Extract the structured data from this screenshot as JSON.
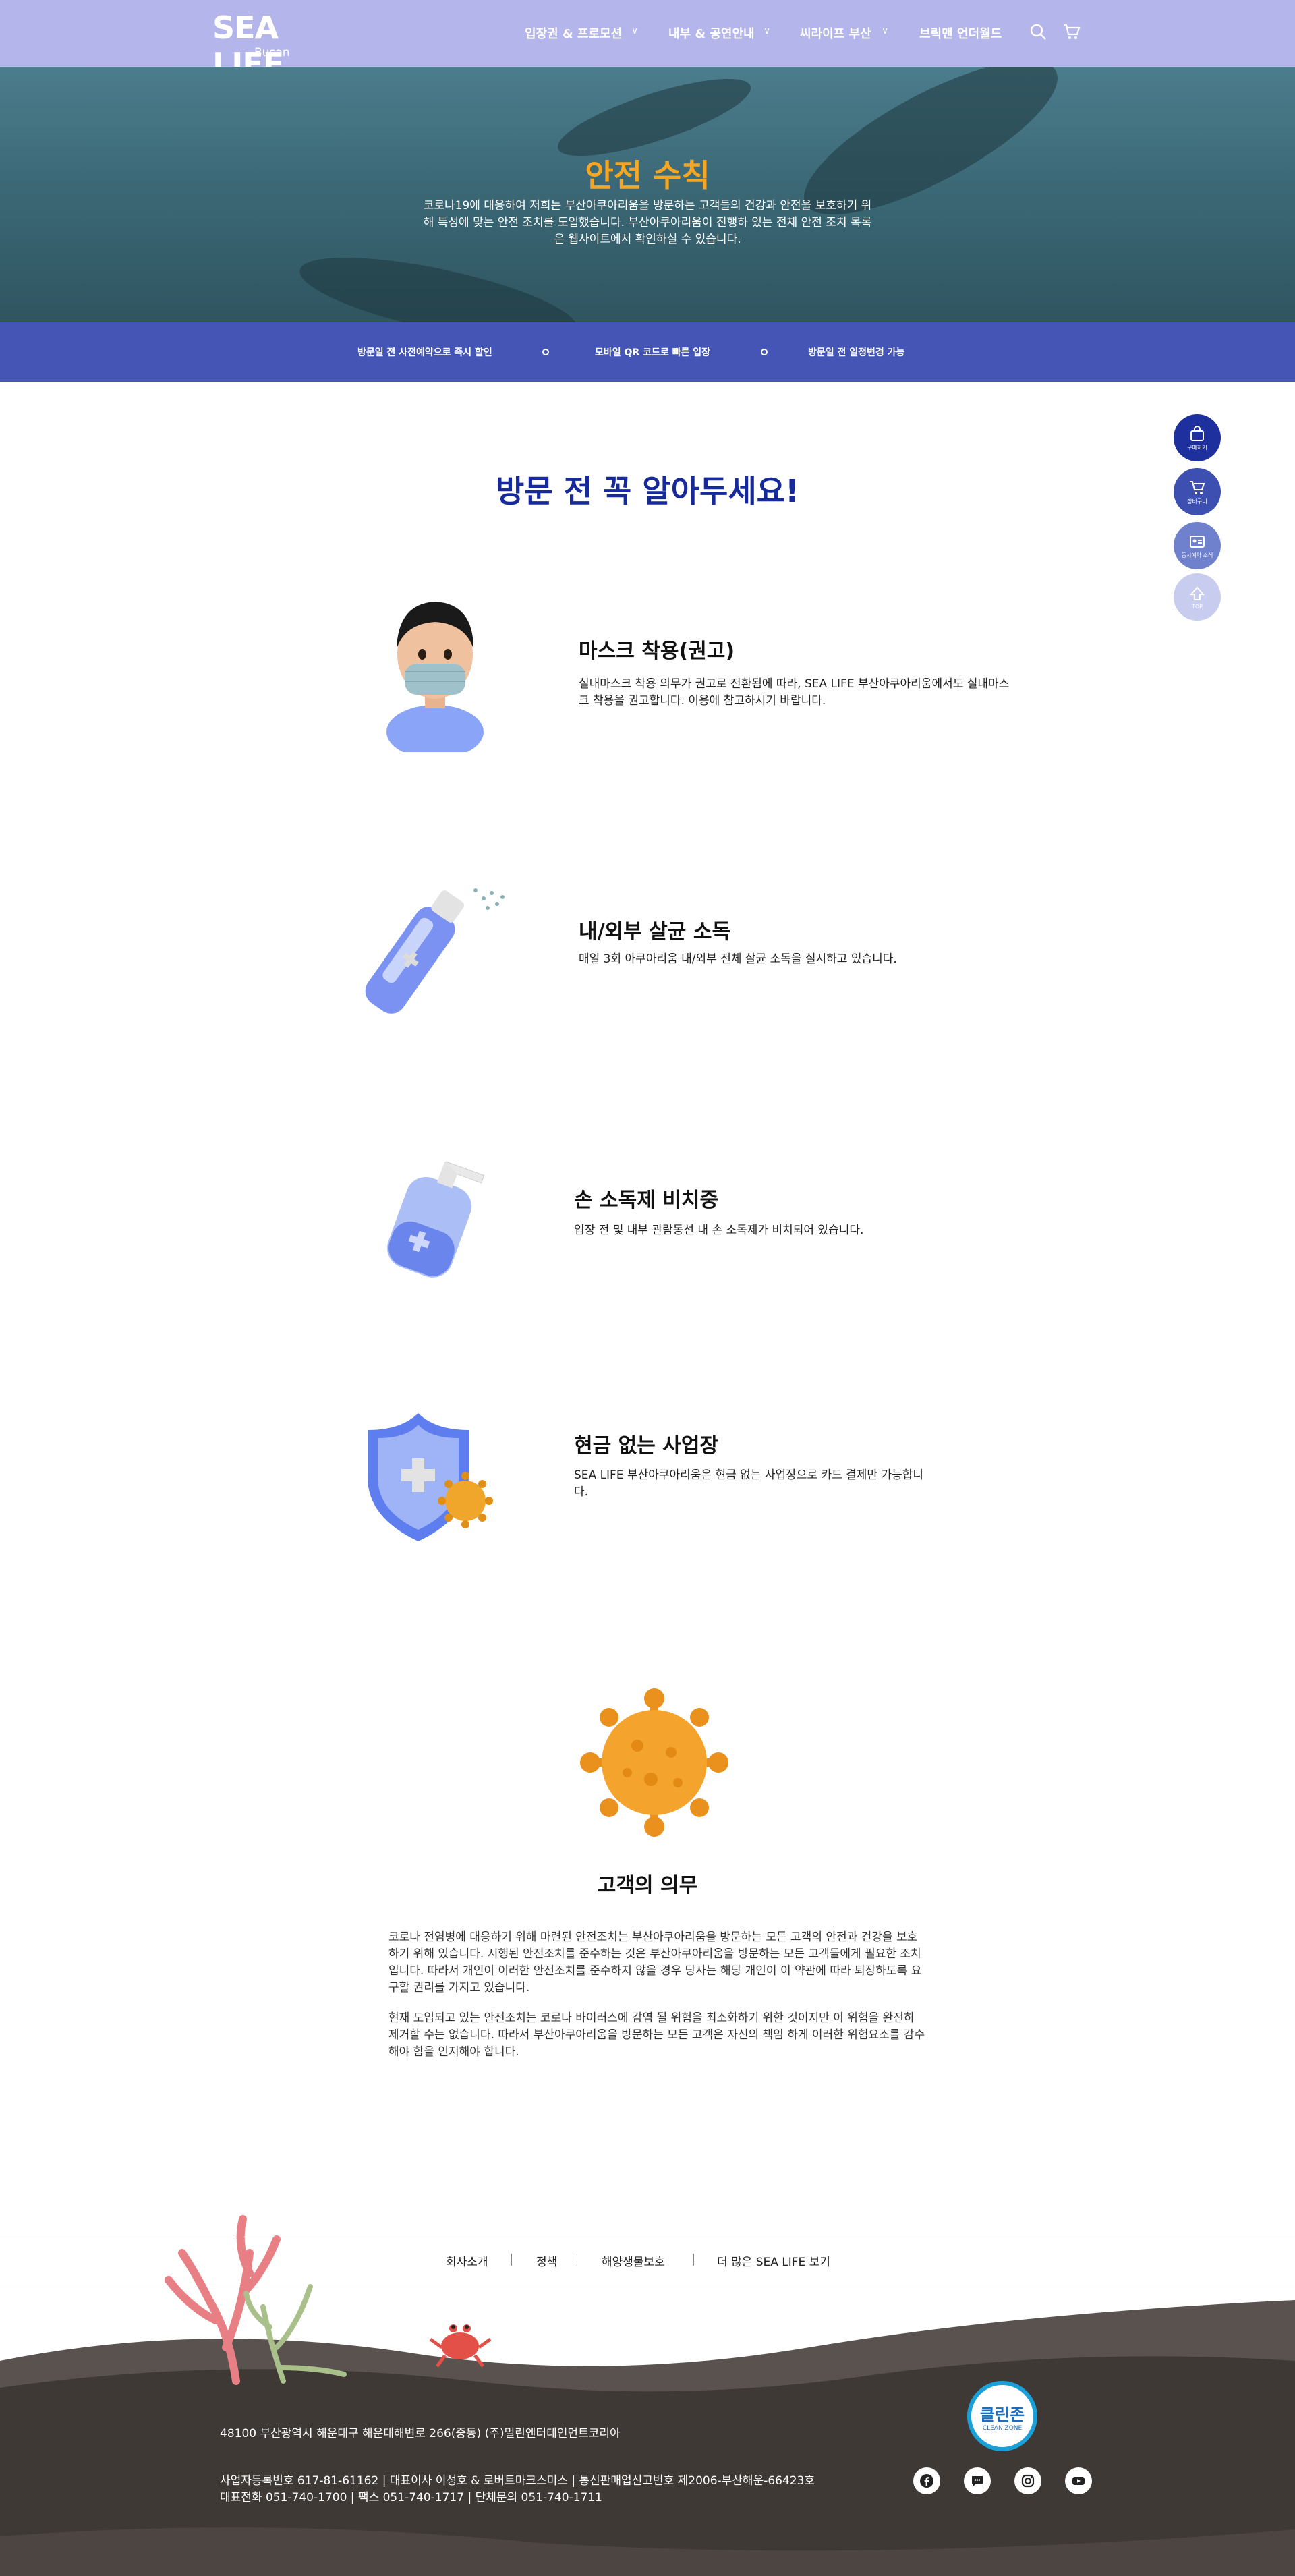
{
  "header": {
    "logo_main": "SEA LIFE",
    "logo_sub": "Busan",
    "nav": [
      {
        "label": "입장권 & 프로모션"
      },
      {
        "label": "내부 & 공연안내"
      },
      {
        "label": "씨라이프 부산"
      },
      {
        "label": "브릭맨 언더월드"
      }
    ]
  },
  "hero": {
    "title": "안전 수칙",
    "text": "코로나19에 대응하여 저희는 부산아쿠아리움을 방문하는 고객들의 건강과 안전을 보호하기 위해 특성에 맞는 안전 조치를 도입했습니다. 부산아쿠아리움이 진행하 있는 전체 안전 조치 목록은 웹사이트에서 확인하실 수 있습니다."
  },
  "band": {
    "items": [
      "방문일 전 사전예약으로 즉시 할인",
      "모바일 QR 코드로 빠른 입장",
      "방문일 전 일정변경 가능"
    ]
  },
  "floating": [
    {
      "label": "구매하기",
      "icon": "shopping-bag-icon"
    },
    {
      "label": "장바구니",
      "icon": "cart-icon"
    },
    {
      "label": "동시예약 소식",
      "icon": "id-card-icon"
    },
    {
      "label": "TOP",
      "icon": "arrow-up-icon"
    }
  ],
  "main": {
    "title": "방문 전 꼭 알아두세요!",
    "items": [
      {
        "title": "마스크 착용(권고)",
        "desc": "실내마스크 착용 의무가 권고로 전환됨에 따라, SEA LIFE 부산아쿠아리움에서도 실내마스크 착용을 권고합니다. 이용에 참고하시기 바랍니다.",
        "icon": "masked-person-icon"
      },
      {
        "title": "내/외부 살균 소독",
        "desc": "매일 3회 아쿠아리움 내/외부 전체 살균 소독을 실시하고 있습니다.",
        "icon": "spray-bottle-icon"
      },
      {
        "title": "손 소독제 비치중",
        "desc": "입장 전 및 내부 관람동선 내 손 소독제가 비치되어 있습니다.",
        "icon": "hand-sanitizer-icon"
      },
      {
        "title": "현금 없는 사업장",
        "desc": "SEA LIFE 부산아쿠아리움은 현금 없는 사업장으로 카드 결제만 가능합니다.",
        "icon": "shield-virus-icon"
      }
    ],
    "duty": {
      "title": "고객의 의무",
      "p1": "코로나 전염병에 대응하기 위해 마련된 안전조치는 부산아쿠아리움을 방문하는 모든 고객의 안전과 건강을 보호하기 위해 있습니다. 시행된 안전조치를 준수하는 것은 부산아쿠아리움을 방문하는 모든 고객들에게 필요한 조치입니다. 따라서 개인이 이러한 안전조치를 준수하지 않을 경우 당사는 해당 개인이 이 약관에 따라 퇴장하도록 요구할 권리를 가지고 있습니다.",
      "p2": "현재 도입되고 있는 안전조치는 코로나 바이러스에 감염 될 위험을 최소화하기 위한 것이지만 이 위험을 완전히 제거할 수는 없습니다. 따라서 부산아쿠아리움을 방문하는 모든 고객은 자신의 책임 하게 이러한 위험요소를 감수해야 함을 인지해야 합니다."
    }
  },
  "footer": {
    "links": [
      "회사소개",
      "정책",
      "해양생물보호",
      "더 많은 SEA LIFE 보기"
    ],
    "address": "48100 부산광역시 해운대구 해운대해변로 266(중동) (주)멀린엔터테인먼트코리아",
    "biz_line1": "사업자등록번호 617-81-61162 | 대표이사 이성호 & 로버트마크스미스 | 통신판매업신고번호 제2006-부산해운-66423호",
    "biz_line2": "대표전화 051-740-1700 | 팩스 051-740-1717 | 단체문의 051-740-1711",
    "badge_title": "클린존",
    "badge_sub": "CLEAN ZONE",
    "social": [
      "facebook-icon",
      "chat-icon",
      "instagram-icon",
      "youtube-icon"
    ]
  },
  "colors": {
    "header": "#b3b5eb",
    "band": "#4455b5",
    "title_blue": "#172a9c",
    "accent_orange": "#f5a623",
    "ground": "#3d3836"
  }
}
